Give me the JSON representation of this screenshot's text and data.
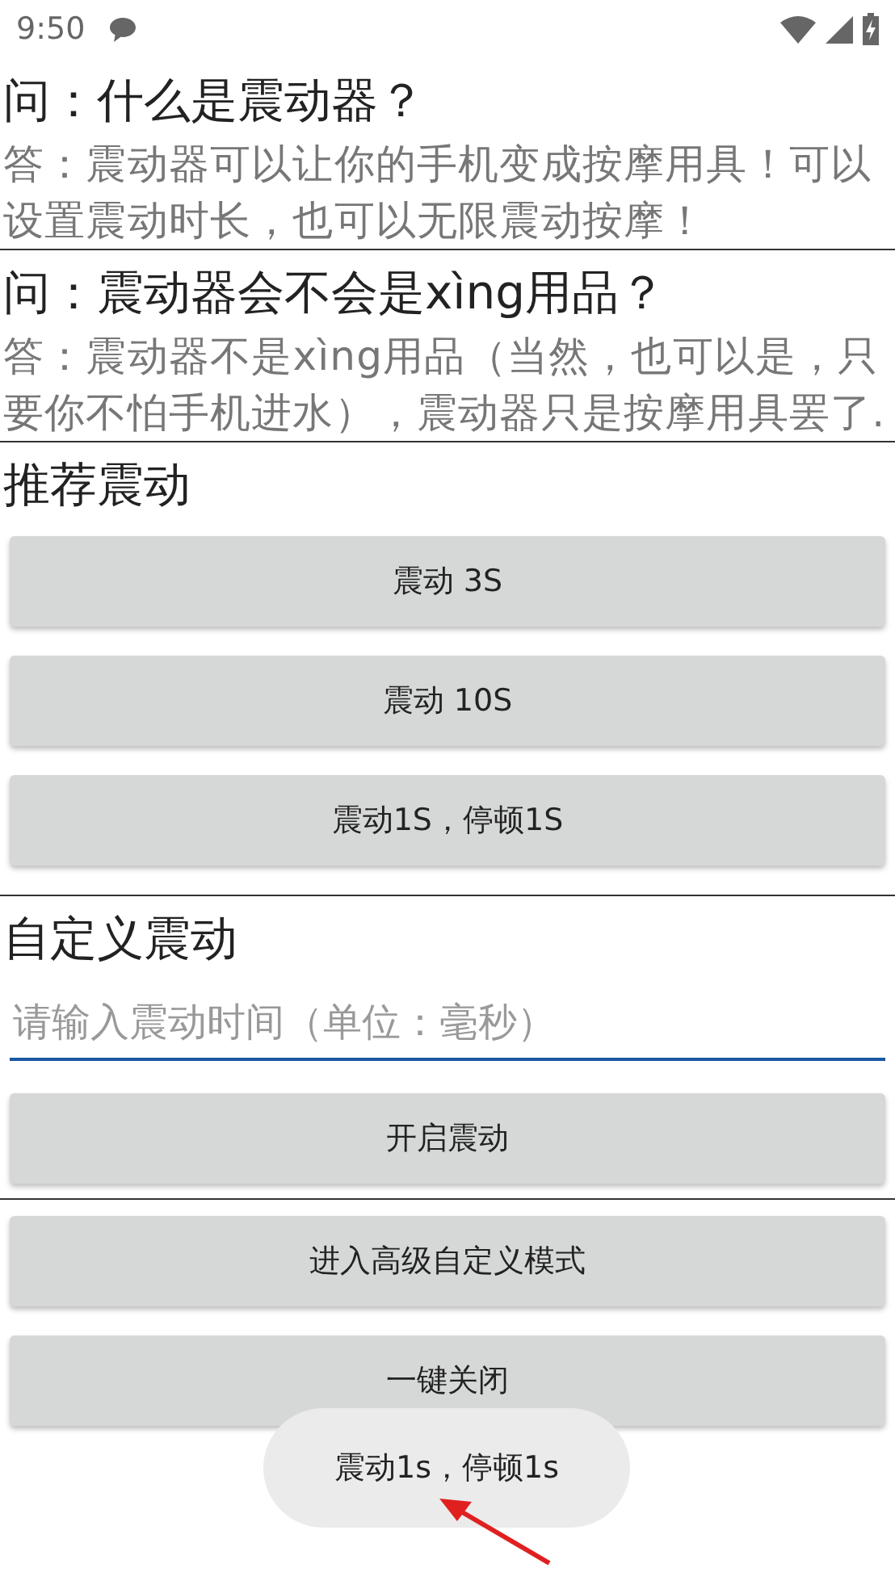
{
  "status_bar": {
    "time": "9:50"
  },
  "faq": [
    {
      "question": "问：什么是震动器？",
      "answer": "答：震动器可以让你的手机变成按摩用具！可以设置震动时长，也可以无限震动按摩！"
    },
    {
      "question": "问：震动器会不会是xìng用品？",
      "answer": "答：震动器不是xìng用品（当然，也可以是，只要你不怕手机进水），震动器只是按摩用具罢了."
    }
  ],
  "recommended": {
    "title": "推荐震动",
    "buttons": [
      "震动 3S",
      "震动 10S",
      "震动1S，停顿1S"
    ]
  },
  "custom": {
    "title": "自定义震动",
    "input": {
      "placeholder": "请输入震动时间（单位：毫秒）"
    },
    "button": "开启震动"
  },
  "bottom_buttons": [
    "进入高级自定义模式",
    "一键关闭"
  ],
  "toast": "震动1s，停顿1s"
}
